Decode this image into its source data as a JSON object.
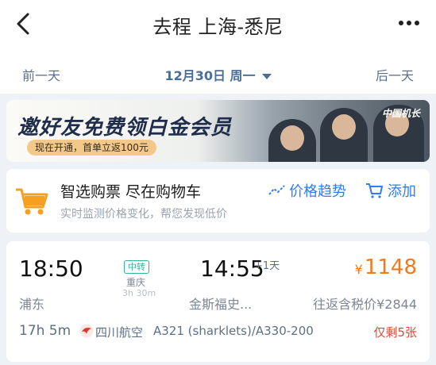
{
  "header": {
    "title": "去程 上海-悉尼"
  },
  "date_bar": {
    "prev_label": "前一天",
    "current_date": "12月30日 周一",
    "next_label": "后一天"
  },
  "banner": {
    "headline": "邀好友免费领白金会员",
    "promo_text": "现在开通，首单立返100元",
    "brand_text": "中国机长"
  },
  "cart_card": {
    "title": "智选购票 尽在购物车",
    "subtitle": "实时监测价格变化，帮您发现低价",
    "trend_label": "价格趋势",
    "add_label": "添加"
  },
  "flight": {
    "departure_time": "18:50",
    "departure_airport": "浦东",
    "transfer_badge": "中转",
    "transfer_city": "重庆",
    "transfer_duration": "3h 30m",
    "arrival_time": "14:55",
    "arrival_day_offset": "+1天",
    "arrival_airport": "金斯福史...",
    "price_symbol": "¥",
    "price": "1148",
    "roundtrip_label": "往返含税价¥2844",
    "duration": "17h 5m",
    "airline": "四川航空",
    "aircraft": "A321 (sharklets)/A330-200",
    "seats_left": "仅剩5张"
  },
  "colors": {
    "accent_blue": "#2e7cf6",
    "price_orange": "#f07a20",
    "transfer_green": "#35b29a",
    "alert_red": "#e2483a",
    "cart_orange": "#f5a020"
  },
  "icons": {
    "back": "chevron-left-icon",
    "more": "more-dots-icon",
    "dropdown": "caret-down-icon",
    "cart": "shopping-cart-icon",
    "trend": "trend-line-icon",
    "add_cart": "add-cart-icon",
    "airline": "sichuan-airlines-logo-icon"
  }
}
